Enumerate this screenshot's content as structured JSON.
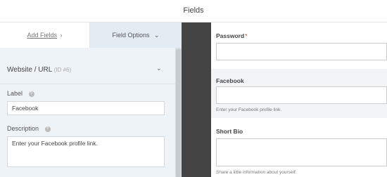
{
  "header": {
    "title": "Fields"
  },
  "tabs": {
    "add_fields": "Add Fields",
    "add_fields_arrow": "›",
    "field_options": "Field Options",
    "field_options_chevron": "⌄"
  },
  "field_options": {
    "field_name": "Website / URL",
    "field_id": "(ID #6)",
    "chevron": "⌄",
    "label_title": "Label",
    "label_value": "Facebook",
    "description_title": "Description",
    "description_value": "Enter your Facebook profile link.",
    "help_icon": "?"
  },
  "preview": {
    "fields": [
      {
        "label": "Password",
        "required_mark": "*",
        "description": ""
      },
      {
        "label": "Facebook",
        "required_mark": "",
        "description": "Enter your Facebook profile link."
      },
      {
        "label": "Short Bio",
        "required_mark": "",
        "description": "Share a little information about yourself."
      }
    ]
  },
  "colors": {
    "left_panel_bg": "#eef3f8",
    "active_tab_bg": "#e4ecf3",
    "divider_bg": "#444444",
    "required_red": "#d63638",
    "selected_field_bg": "#f3f4f6"
  }
}
